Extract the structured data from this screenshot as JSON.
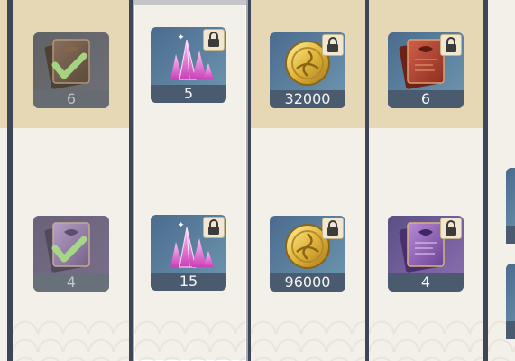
{
  "colors": {
    "background": "#3d4557",
    "column": "#f3efe9",
    "highlight_band": "#e7d8b5",
    "card_purple": "#8c6fb5",
    "card_blue": "#6e97b0",
    "quantity_bar": "#4a5b6f",
    "check": "#7ee04a",
    "lock_bg": "#f1e6cf"
  },
  "columns": [
    {
      "id": "col-1",
      "rows": [
        {
          "icon": "book-completed-icon",
          "quantity": "6",
          "claimed": true,
          "locked": false
        },
        {
          "icon": "book-completed-icon",
          "quantity": "4",
          "claimed": true,
          "locked": false
        }
      ]
    },
    {
      "id": "col-2",
      "selected": true,
      "rows": [
        {
          "icon": "crystal-icon",
          "quantity": "5",
          "claimed": false,
          "locked": true
        },
        {
          "icon": "crystal-icon",
          "quantity": "15",
          "claimed": false,
          "locked": true
        }
      ]
    },
    {
      "id": "col-3",
      "rows": [
        {
          "icon": "gold-coin-icon",
          "quantity": "32000",
          "claimed": false,
          "locked": true
        },
        {
          "icon": "gold-coin-icon",
          "quantity": "96000",
          "claimed": false,
          "locked": true
        }
      ]
    },
    {
      "id": "col-4",
      "rows": [
        {
          "icon": "book-icon",
          "quantity": "6",
          "claimed": false,
          "locked": true
        },
        {
          "icon": "book-icon",
          "quantity": "4",
          "claimed": false,
          "locked": true
        }
      ]
    }
  ]
}
